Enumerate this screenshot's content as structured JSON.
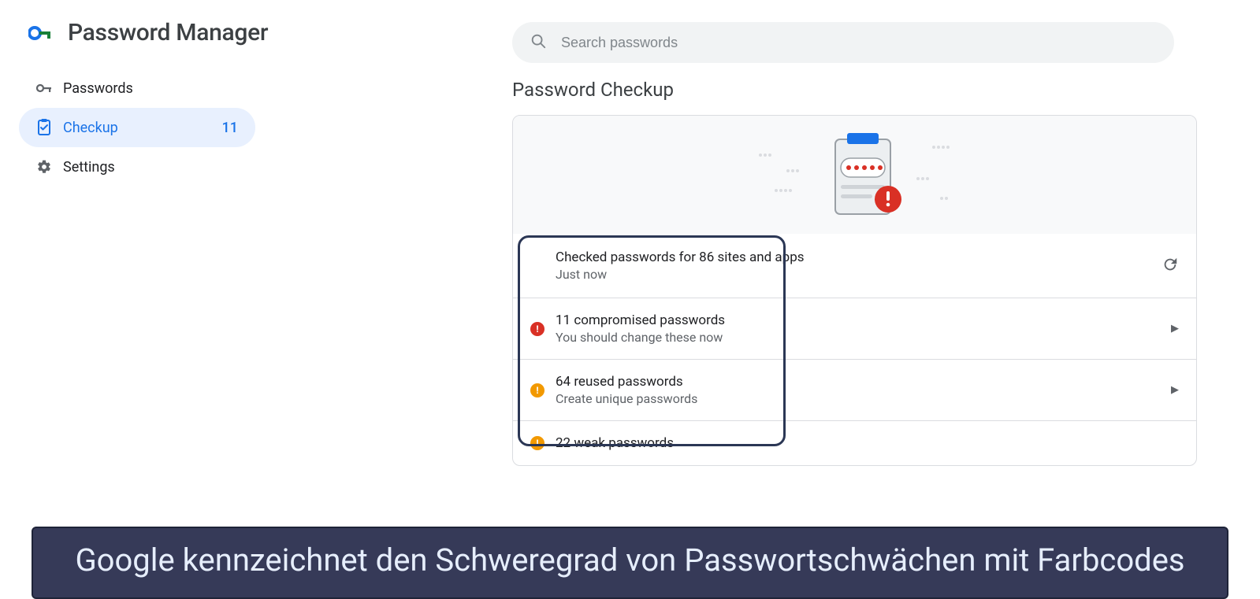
{
  "app": {
    "title": "Password Manager"
  },
  "search": {
    "placeholder": "Search passwords"
  },
  "sidebar": {
    "items": [
      {
        "label": "Passwords"
      },
      {
        "label": "Checkup",
        "badge": "11"
      },
      {
        "label": "Settings"
      }
    ]
  },
  "page": {
    "title": "Password Checkup"
  },
  "checkup": {
    "summary_title": "Checked passwords for 86 sites and apps",
    "summary_subtitle": "Just now",
    "rows": [
      {
        "title": "11 compromised passwords",
        "subtitle": "You should change these now",
        "severity": "red"
      },
      {
        "title": "64 reused passwords",
        "subtitle": "Create unique passwords",
        "severity": "orange"
      },
      {
        "title": "22 weak passwords",
        "subtitle": "",
        "severity": "orange"
      }
    ]
  },
  "caption": "Google kennzeichnet den Schweregrad von Passwortschwächen mit Farbcodes"
}
